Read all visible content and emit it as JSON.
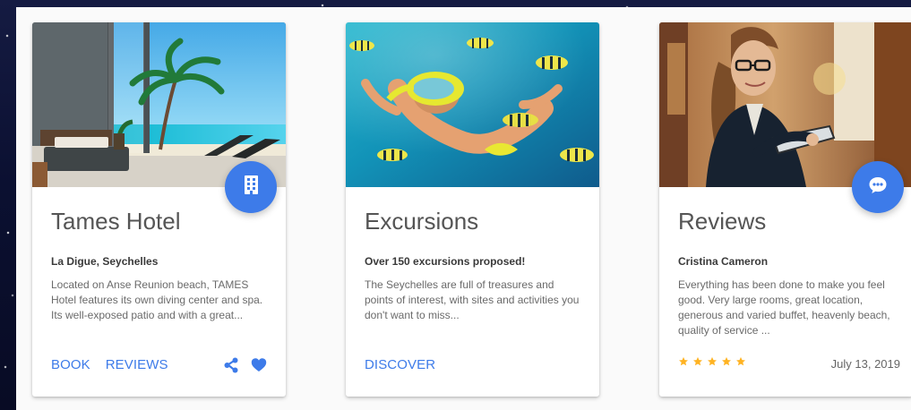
{
  "colors": {
    "accent": "#3d7be9",
    "rating_star": "#ffb322",
    "text_title": "#555555"
  },
  "cards": {
    "hotel": {
      "title": "Tames Hotel",
      "subtitle": "La Digue, Seychelles",
      "description": "Located on Anse Reunion beach, TAMES Hotel features its own diving center and spa. Its well-exposed patio and with a great...",
      "fab_icon": "hotel-building-icon",
      "actions": {
        "book_label": "BOOK",
        "reviews_label": "REVIEWS",
        "share_icon": "share-icon",
        "favorite_icon": "heart-icon"
      }
    },
    "excursions": {
      "title": "Excursions",
      "subtitle": "Over 150 excursions proposed!",
      "description": "The Seychelles are full of treasures and points of interest, with sites and activities you don't want to miss...",
      "actions": {
        "discover_label": "DISCOVER"
      }
    },
    "reviews": {
      "title": "Reviews",
      "subtitle": "Cristina Cameron",
      "description": "Everything has been done to make you feel good. Very large rooms, great location, generous and varied buffet, heavenly beach, quality of service ...",
      "fab_icon": "chat-bubble-icon",
      "rating": 5,
      "rating_max": 5,
      "date": "July 13, 2019"
    }
  }
}
